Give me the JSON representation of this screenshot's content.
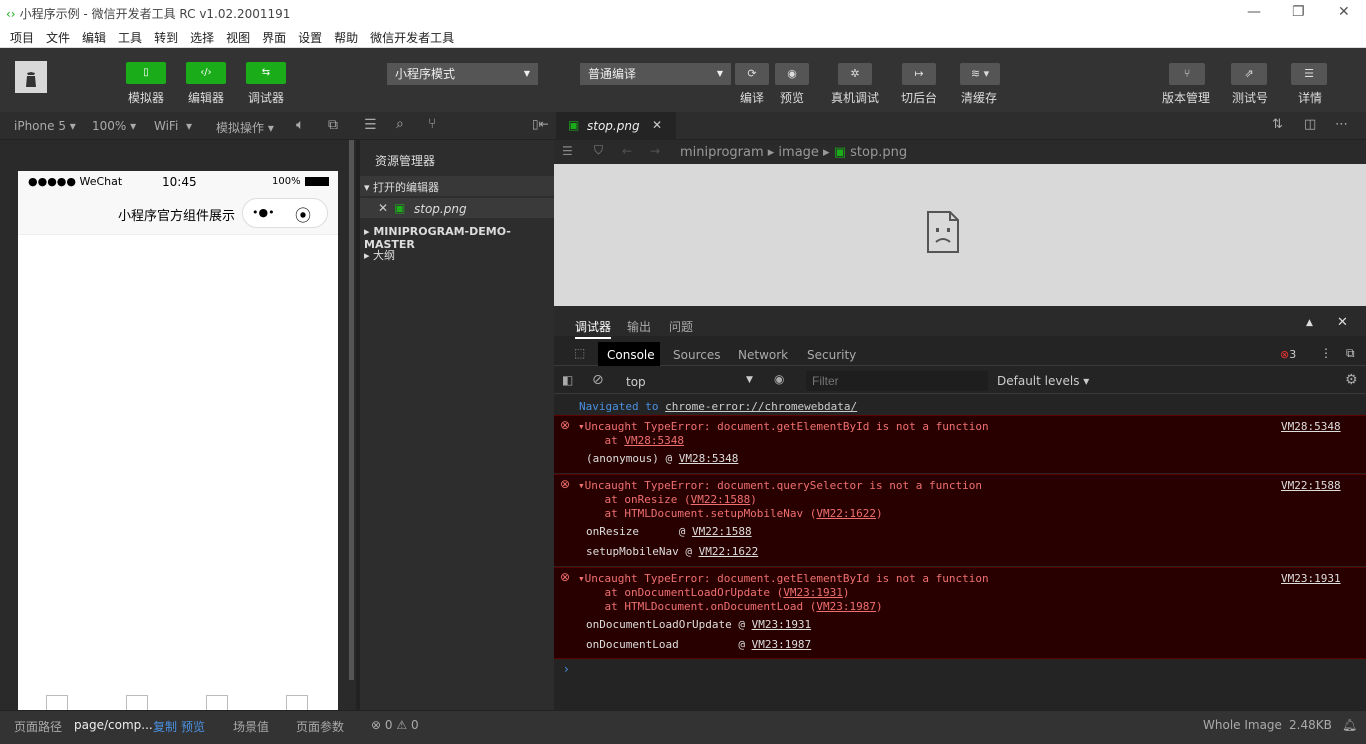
{
  "title": "小程序示例 - 微信开发者工具 RC v1.02.2001191",
  "window_controls": [
    "—",
    "❐",
    "✕"
  ],
  "menu": [
    "项目",
    "文件",
    "编辑",
    "工具",
    "转到",
    "选择",
    "视图",
    "界面",
    "设置",
    "帮助",
    "微信开发者工具"
  ],
  "toolbar": {
    "simulator": "模拟器",
    "editor": "编辑器",
    "debugger": "调试器",
    "mode": "小程序模式",
    "compile_mode": "普通编译",
    "compile": "编译",
    "preview": "预览",
    "remote_debug": "真机调试",
    "background": "切后台",
    "clear_cache": "清缓存",
    "version": "版本管理",
    "test_id": "测试号",
    "details": "详情"
  },
  "subbar": {
    "device": "iPhone 5",
    "zoom": "100%",
    "network": "WiFi",
    "simulate": "模拟操作"
  },
  "phone": {
    "carrier": "●●●●● WeChat",
    "time": "10:45",
    "battery": "100%",
    "nav_title": "小程序官方组件展示",
    "capsule_more": "•●•"
  },
  "explorer": {
    "header": "资源管理器",
    "open_editors": "打开的编辑器",
    "open_file": "stop.png",
    "project": "MINIPROGRAM-DEMO-MASTER",
    "outline": "大纲"
  },
  "editor": {
    "tab": "stop.png",
    "breadcrumb": [
      "miniprogram",
      "image",
      "stop.png"
    ]
  },
  "debug": {
    "tabs": [
      "调试器",
      "输出",
      "问题"
    ],
    "devtabs": [
      "Console",
      "Sources",
      "Network",
      "Security"
    ],
    "error_count": "3",
    "context": "top",
    "filter_placeholder": "Filter",
    "levels": "Default levels ▾",
    "navigated_prefix": "Navigated to",
    "navigated_url": "chrome-error://chromewebdata/",
    "errors": [
      {
        "message": "▾Uncaught TypeError: document.getElementById is not a function",
        "source": "VM28:5348",
        "stack": [
          {
            "pre": "    at ",
            "link": "VM28:5348",
            "post": ""
          }
        ],
        "frames": [
          {
            "name": "(anonymous)",
            "link": "VM28:5348"
          }
        ]
      },
      {
        "message": "▾Uncaught TypeError: document.querySelector is not a function",
        "source": "VM22:1588",
        "stack": [
          {
            "pre": "    at onResize (",
            "link": "VM22:1588",
            "post": ")"
          },
          {
            "pre": "    at HTMLDocument.setupMobileNav (",
            "link": "VM22:1622",
            "post": ")"
          }
        ],
        "frames": [
          {
            "name": "onResize      ",
            "link": "VM22:1588"
          },
          {
            "name": "setupMobileNav",
            "link": "VM22:1622"
          }
        ]
      },
      {
        "message": "▾Uncaught TypeError: document.getElementById is not a function",
        "source": "VM23:1931",
        "stack": [
          {
            "pre": "    at onDocumentLoadOrUpdate (",
            "link": "VM23:1931",
            "post": ")"
          },
          {
            "pre": "    at HTMLDocument.onDocumentLoad (",
            "link": "VM23:1987",
            "post": ")"
          }
        ],
        "frames": [
          {
            "name": "onDocumentLoadOrUpdate",
            "link": "VM23:1931"
          },
          {
            "name": "onDocumentLoad        ",
            "link": "VM23:1987"
          }
        ]
      }
    ]
  },
  "statusbar": {
    "path_label": "页面路径",
    "path": "page/comp...",
    "copy": "复制",
    "preview": "预览",
    "scene": "场景值",
    "params": "页面参数",
    "errors": "0",
    "warnings": "0",
    "whole_image": "Whole Image",
    "size": "2.48KB"
  },
  "colors": {
    "accent": "#1aad19",
    "error_bg": "#290000",
    "error_text": "#ef6f6f",
    "link": "#4a90e2"
  }
}
